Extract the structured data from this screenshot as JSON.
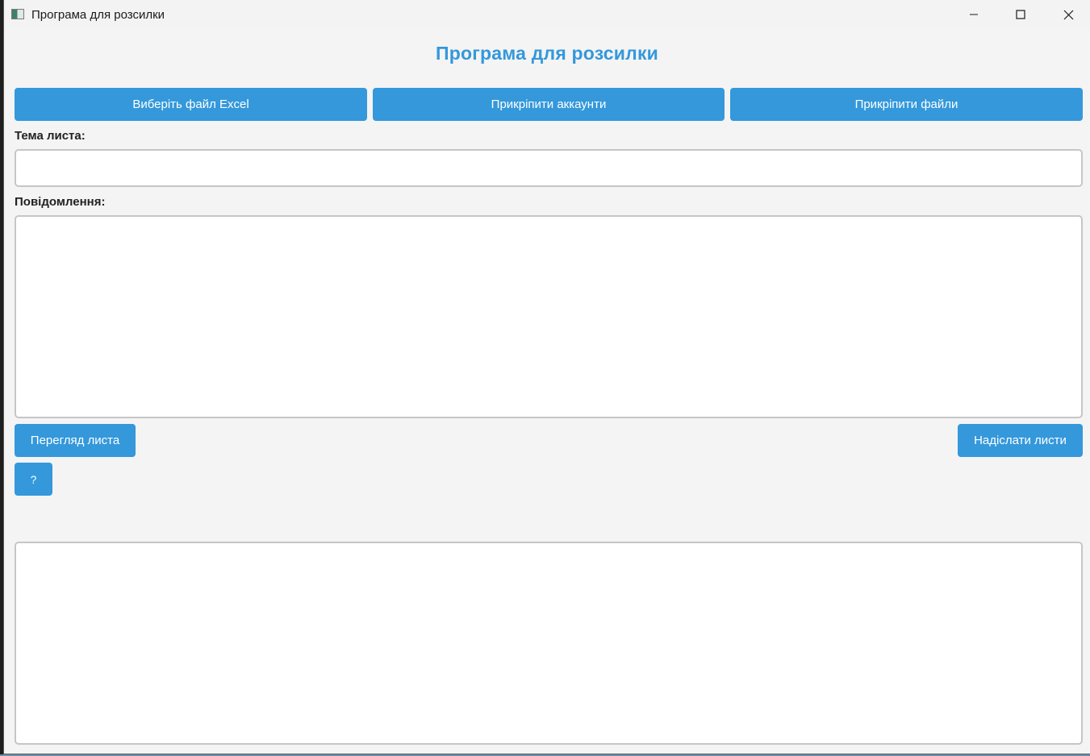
{
  "window": {
    "title": "Програма для розсилки",
    "controls": {
      "minimize_icon": "minimize-icon",
      "maximize_icon": "maximize-icon",
      "close_icon": "close-icon"
    }
  },
  "app": {
    "heading": "Програма для розсилки",
    "accent_color": "#3498db"
  },
  "toolbar": {
    "select_excel_label": "Виберіть файл Excel",
    "attach_accounts_label": "Прикріпити аккаунти",
    "attach_files_label": "Прикріпити файли"
  },
  "form": {
    "subject_label": "Тема листа:",
    "subject_value": "",
    "message_label": "Повідомлення:",
    "message_value": ""
  },
  "actions": {
    "preview_label": "Перегляд листа",
    "send_label": "Надіслати листи",
    "help_label": "?"
  },
  "log": {
    "value": ""
  }
}
